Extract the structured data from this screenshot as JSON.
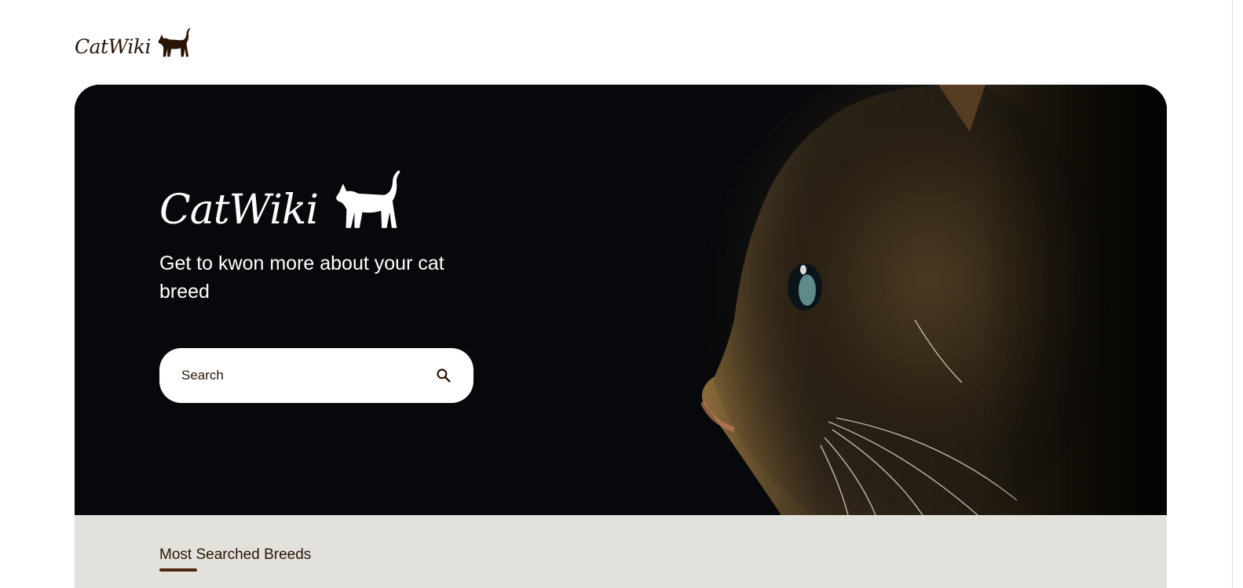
{
  "header": {
    "logo_text": "CatWiki"
  },
  "hero": {
    "logo_text": "CatWiki",
    "tagline": "Get to kwon more about your cat breed",
    "search": {
      "placeholder": "Search",
      "value": ""
    }
  },
  "breeds_section": {
    "title": "Most Searched Breeds"
  },
  "colors": {
    "brand_dark": "#291507",
    "hero_bg": "#06080b",
    "section_bg": "#e3e1dc",
    "underline": "#4d270c"
  },
  "icons": {
    "search": "search-icon",
    "logo_cat": "cat-silhouette-icon"
  }
}
